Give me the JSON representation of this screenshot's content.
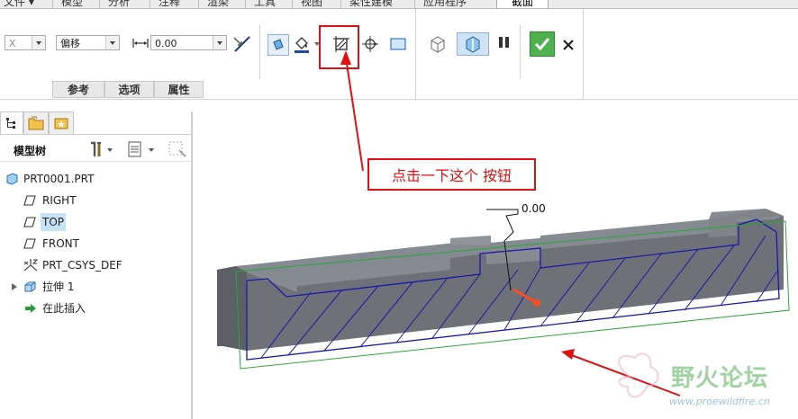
{
  "menu_tabs": [
    "文件 ▾",
    "模型",
    "分析",
    "注释",
    "渲染",
    "工具",
    "视图",
    "柔性建模",
    "应用程序"
  ],
  "active_tab": "截面",
  "ribbon": {
    "axis_combo": "X",
    "mode_combo": "偏移",
    "offset_value": "0.00",
    "subtabs": [
      "参考",
      "选项",
      "属性"
    ]
  },
  "left_panel": {
    "title": "模型树",
    "tree": [
      {
        "label": "PRT0001.PRT"
      },
      {
        "label": "RIGHT"
      },
      {
        "label": "TOP"
      },
      {
        "label": "FRONT"
      },
      {
        "label": "PRT_CSYS_DEF"
      },
      {
        "label": "拉伸 1"
      },
      {
        "label": "在此插入"
      }
    ]
  },
  "viewport": {
    "dimension_value": "0.00",
    "annotation": "点击一下这个 按钮"
  },
  "watermark": {
    "name": "野火论坛",
    "url": "www.proewildfire.cn"
  },
  "colors": {
    "annotation_red": "#d11111",
    "section_blue": "#1a1aa8",
    "boundary_green": "#2aa63a",
    "confirm_green": "#3aa53a",
    "part_gray": "#6e7178"
  }
}
